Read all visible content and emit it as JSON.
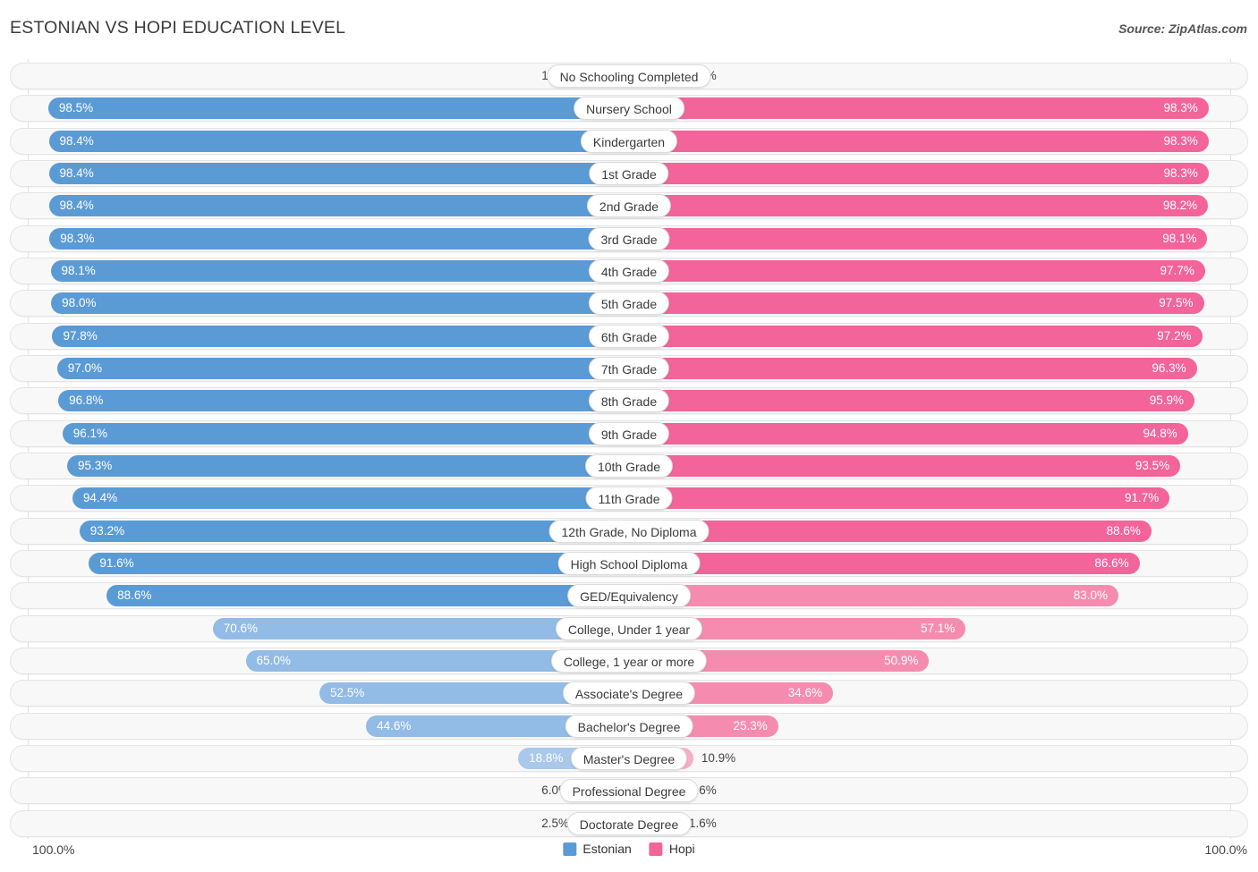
{
  "header": {
    "title": "ESTONIAN VS HOPI EDUCATION LEVEL",
    "source": "Source: ZipAtlas.com"
  },
  "legend": {
    "items": [
      {
        "label": "Estonian",
        "color": "#5b9bd5"
      },
      {
        "label": "Hopi",
        "color": "#f2649a"
      }
    ]
  },
  "axis": {
    "left_max": "100.0%",
    "right_max": "100.0%"
  },
  "colors": {
    "estonian_strong": "#5b9bd5",
    "estonian_light": "#92bbe6",
    "estonian_lighter": "#a9c8ea",
    "hopi_strong": "#f2649a",
    "hopi_light": "#f58cb0",
    "hopi_lighter": "#f7aec7",
    "track_bg": "#f8f8f8",
    "track_border": "#e4e4e4"
  },
  "chart_data": {
    "type": "bar",
    "orientation": "horizontal-diverging",
    "title": "ESTONIAN VS HOPI EDUCATION LEVEL",
    "xlabel": "",
    "ylabel": "",
    "xlim": [
      0,
      100
    ],
    "unit": "%",
    "grid": true,
    "legend_position": "bottom-center",
    "categories": [
      "No Schooling Completed",
      "Nursery School",
      "Kindergarten",
      "1st Grade",
      "2nd Grade",
      "3rd Grade",
      "4th Grade",
      "5th Grade",
      "6th Grade",
      "7th Grade",
      "8th Grade",
      "9th Grade",
      "10th Grade",
      "11th Grade",
      "12th Grade, No Diploma",
      "High School Diploma",
      "GED/Equivalency",
      "College, Under 1 year",
      "College, 1 year or more",
      "Associate's Degree",
      "Bachelor's Degree",
      "Master's Degree",
      "Professional Degree",
      "Doctorate Degree"
    ],
    "series": [
      {
        "name": "Estonian",
        "color": "#5b9bd5",
        "values": [
          1.6,
          98.5,
          98.4,
          98.4,
          98.4,
          98.3,
          98.1,
          98.0,
          97.8,
          97.0,
          96.8,
          96.1,
          95.3,
          94.4,
          93.2,
          91.6,
          88.6,
          70.6,
          65.0,
          52.5,
          44.6,
          18.8,
          6.0,
          2.5
        ],
        "labels": [
          "1.6%",
          "98.5%",
          "98.4%",
          "98.4%",
          "98.4%",
          "98.3%",
          "98.1%",
          "98.0%",
          "97.8%",
          "97.0%",
          "96.8%",
          "96.1%",
          "95.3%",
          "94.4%",
          "93.2%",
          "91.6%",
          "88.6%",
          "70.6%",
          "65.0%",
          "52.5%",
          "44.6%",
          "18.8%",
          "6.0%",
          "2.5%"
        ]
      },
      {
        "name": "Hopi",
        "color": "#f2649a",
        "values": [
          2.2,
          98.3,
          98.3,
          98.3,
          98.2,
          98.1,
          97.7,
          97.5,
          97.2,
          96.3,
          95.9,
          94.8,
          93.5,
          91.7,
          88.6,
          86.6,
          83.0,
          57.1,
          50.9,
          34.6,
          25.3,
          10.9,
          3.6,
          1.6
        ],
        "labels": [
          "2.2%",
          "98.3%",
          "98.3%",
          "98.3%",
          "98.2%",
          "98.1%",
          "97.7%",
          "97.5%",
          "97.2%",
          "96.3%",
          "95.9%",
          "94.8%",
          "93.5%",
          "91.7%",
          "88.6%",
          "86.6%",
          "83.0%",
          "57.1%",
          "50.9%",
          "34.6%",
          "25.3%",
          "10.9%",
          "3.6%",
          "1.6%"
        ]
      }
    ]
  }
}
